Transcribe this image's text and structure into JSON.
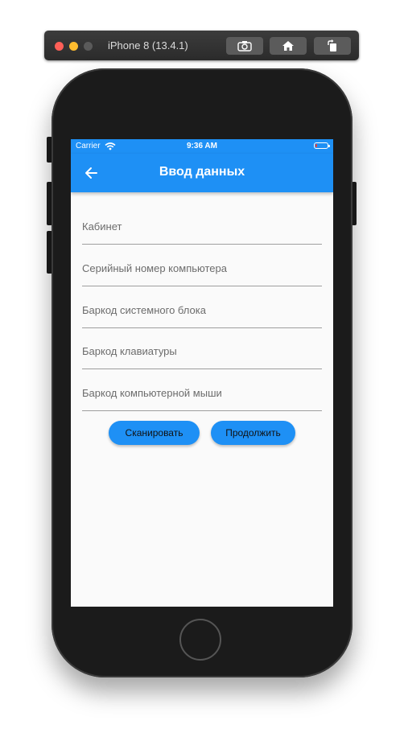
{
  "simulator": {
    "title": "iPhone 8 (13.4.1)",
    "buttons": [
      "screenshot-icon",
      "home-icon",
      "rotate-icon"
    ]
  },
  "status_bar": {
    "carrier": "Carrier",
    "time": "9:36 AM",
    "battery_color": "#ff3b30"
  },
  "app_bar": {
    "title": "Ввод данных",
    "back_icon": "arrow-left-icon",
    "color": "#1e90f5"
  },
  "form": {
    "fields": [
      {
        "placeholder": "Кабинет",
        "value": ""
      },
      {
        "placeholder": "Серийный номер компьютера",
        "value": ""
      },
      {
        "placeholder": "Баркод системного блока",
        "value": ""
      },
      {
        "placeholder": "Баркод клавиатуры",
        "value": ""
      },
      {
        "placeholder": "Баркод компьютерной мыши",
        "value": ""
      }
    ],
    "scan_label": "Сканировать",
    "continue_label": "Продолжить"
  }
}
